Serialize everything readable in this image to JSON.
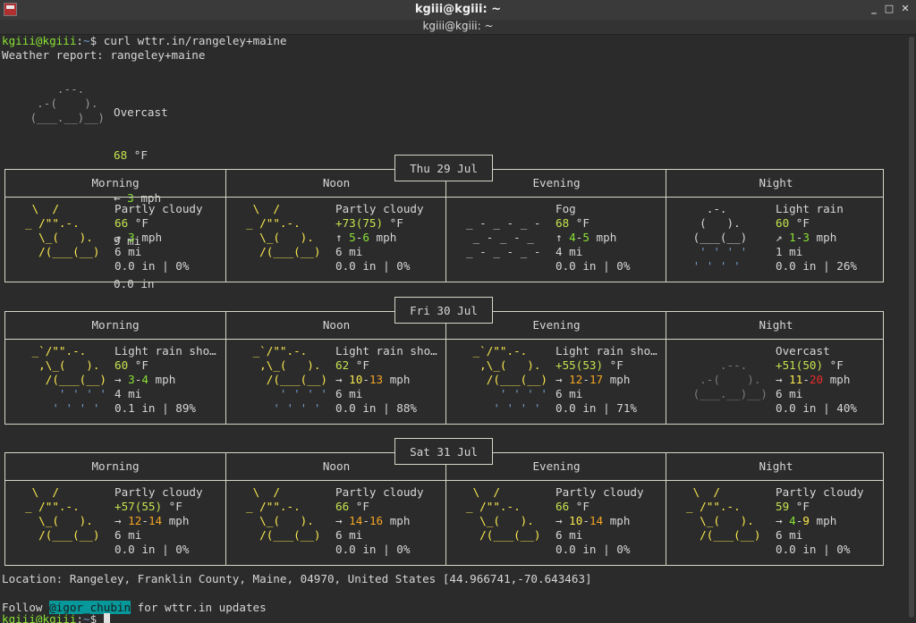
{
  "window": {
    "title": "kgiii@kgiii: ~",
    "tab_title": "kgiii@kgiii: ~"
  },
  "prompt": {
    "user_host": "kgiii@kgiii",
    "sep": ":",
    "path": "~",
    "symbol": "$ ",
    "command": "curl wttr.in/rangeley+maine"
  },
  "report_header": "Weather report: rangeley+maine",
  "current": {
    "icon": [
      "     .--.",
      "  .-(    ).",
      " (___.__)__)"
    ],
    "condition": "Overcast",
    "temp": "68",
    "temp_unit": " °F",
    "wind_dir": "← ",
    "wind": "3",
    "wind_unit": " mph",
    "visibility": "9 mi",
    "precip": "0.0 in"
  },
  "forecast": [
    {
      "date": "Thu 29 Jul",
      "periods": [
        {
          "name": "Morning",
          "icon": [
            " \\  /",
            "_ /\"\".-.",
            "  \\_(   ).",
            "  /(___(__)"
          ],
          "icon_color": "#fce94f",
          "condition": "Partly cloudy",
          "temp_a": "66",
          "temp_b": "",
          "temp_unit": " °F",
          "wind_dir": "↗ ",
          "wind_a": "3",
          "wind_b": "",
          "wind_unit": " mph",
          "visibility": "6 mi",
          "precip": "0.0 in | 0%"
        },
        {
          "name": "Noon",
          "icon": [
            " \\  /",
            "_ /\"\".-.",
            "  \\_(   ).",
            "  /(___(__)"
          ],
          "icon_color": "#fce94f",
          "condition": "Partly cloudy",
          "temp_a": "+73",
          "temp_b": "(75)",
          "temp_unit": " °F",
          "wind_dir": "↑ ",
          "wind_a": "5",
          "wind_b": "6",
          "wind_unit": " mph",
          "visibility": "6 mi",
          "precip": "0.0 in | 0%"
        },
        {
          "name": "Evening",
          "icon": [
            "",
            "_ - _ - _ -",
            " _ - _ - _",
            "_ - _ - _ -"
          ],
          "icon_color": "#d6d6d6",
          "condition": "Fog",
          "temp_a": "68",
          "temp_b": "",
          "temp_unit": " °F",
          "wind_dir": "↑ ",
          "wind_a": "4",
          "wind_b": "5",
          "wind_unit": " mph",
          "visibility": "4 mi",
          "precip": "0.0 in | 0%"
        },
        {
          "name": "Night",
          "icon": [
            "   .-.",
            "  (   ).",
            " (___(__)",
            "  ' ' ' '",
            " ' ' ' '"
          ],
          "icon_color": "#d6d6d6",
          "condition": "Light rain",
          "temp_a": "60",
          "temp_b": "",
          "temp_unit": " °F",
          "wind_dir": "↗ ",
          "wind_a": "1",
          "wind_b": "3",
          "wind_unit": " mph",
          "visibility": "1 mi",
          "precip": "0.0 in | 26%"
        }
      ]
    },
    {
      "date": "Fri 30 Jul",
      "periods": [
        {
          "name": "Morning",
          "icon": [
            " _`/\"\".-.",
            "  ,\\_(   ).",
            "   /(___(__)",
            "     ' ' ' '",
            "    ' ' ' '"
          ],
          "icon_color": "#fce94f",
          "condition": "Light rain sho…",
          "temp_a": "60",
          "temp_b": "",
          "temp_unit": " °F",
          "wind_dir": "→ ",
          "wind_a": "3",
          "wind_b": "4",
          "wind_unit": " mph",
          "visibility": "4 mi",
          "precip": "0.1 in | 89%"
        },
        {
          "name": "Noon",
          "icon": [
            " _`/\"\".-.",
            "  ,\\_(   ).",
            "   /(___(__)",
            "     ' ' ' '",
            "    ' ' ' '"
          ],
          "icon_color": "#fce94f",
          "condition": "Light rain sho…",
          "temp_a": "62",
          "temp_b": "",
          "temp_unit": " °F",
          "wind_dir": "→ ",
          "wind_a": "10",
          "wind_b": "13",
          "wind_unit": " mph",
          "visibility": "6 mi",
          "precip": "0.0 in | 88%"
        },
        {
          "name": "Evening",
          "icon": [
            " _`/\"\".-.",
            "  ,\\_(   ).",
            "   /(___(__)",
            "     ' ' ' '",
            "    ' ' ' '"
          ],
          "icon_color": "#fce94f",
          "condition": "Light rain sho…",
          "temp_a": "+55",
          "temp_b": "(53)",
          "temp_unit": " °F",
          "wind_dir": "→ ",
          "wind_a": "12",
          "wind_b": "17",
          "wind_unit": " mph",
          "visibility": "6 mi",
          "precip": "0.0 in | 71%"
        },
        {
          "name": "Night",
          "icon": [
            "",
            "     .--.",
            "  .-(    ).",
            " (___.__)__)"
          ],
          "icon_color": "#7a7a7a",
          "condition": "Overcast",
          "temp_a": "+51",
          "temp_b": "(50)",
          "temp_unit": " °F",
          "wind_dir": "→ ",
          "wind_a": "11",
          "wind_b": "20",
          "wind_unit": " mph",
          "visibility": "6 mi",
          "precip": "0.0 in | 40%"
        }
      ]
    },
    {
      "date": "Sat 31 Jul",
      "periods": [
        {
          "name": "Morning",
          "icon": [
            " \\  /",
            "_ /\"\".-.",
            "  \\_(   ).",
            "  /(___(__)"
          ],
          "icon_color": "#fce94f",
          "condition": "Partly cloudy",
          "temp_a": "+57",
          "temp_b": "(55)",
          "temp_unit": " °F",
          "wind_dir": "→ ",
          "wind_a": "12",
          "wind_b": "14",
          "wind_unit": " mph",
          "visibility": "6 mi",
          "precip": "0.0 in | 0%"
        },
        {
          "name": "Noon",
          "icon": [
            " \\  /",
            "_ /\"\".-.",
            "  \\_(   ).",
            "  /(___(__)"
          ],
          "icon_color": "#fce94f",
          "condition": "Partly cloudy",
          "temp_a": "66",
          "temp_b": "",
          "temp_unit": " °F",
          "wind_dir": "→ ",
          "wind_a": "14",
          "wind_b": "16",
          "wind_unit": " mph",
          "visibility": "6 mi",
          "precip": "0.0 in | 0%"
        },
        {
          "name": "Evening",
          "icon": [
            " \\  /",
            "_ /\"\".-.",
            "  \\_(   ).",
            "  /(___(__)"
          ],
          "icon_color": "#fce94f",
          "condition": "Partly cloudy",
          "temp_a": "66",
          "temp_b": "",
          "temp_unit": " °F",
          "wind_dir": "→ ",
          "wind_a": "10",
          "wind_b": "14",
          "wind_unit": " mph",
          "visibility": "6 mi",
          "precip": "0.0 in | 0%"
        },
        {
          "name": "Night",
          "icon": [
            " \\  /",
            "_ /\"\".-.",
            "  \\_(   ).",
            "  /(___(__)"
          ],
          "icon_color": "#fce94f",
          "condition": "Partly cloudy",
          "temp_a": "59",
          "temp_b": "",
          "temp_unit": " °F",
          "wind_dir": "→ ",
          "wind_a": "4",
          "wind_b": "9",
          "wind_unit": " mph",
          "visibility": "6 mi",
          "precip": "0.0 in | 0%"
        }
      ]
    }
  ],
  "location_line": "Location: Rangeley, Franklin County, Maine, 04970, United States [44.966741,-70.643463]",
  "follow": {
    "prefix": "Follow ",
    "handle": "@igor_chubin",
    "suffix": " for wttr.in updates"
  },
  "prompt2": {
    "user_host": "kgiii@kgiii",
    "sep": ":",
    "path": "~",
    "symbol": "$ "
  },
  "icons": {
    "app": "terminal-icon",
    "minimize": "_",
    "maximize": "□",
    "close": "✕"
  },
  "colors": {
    "background": "#2b2b2b",
    "prompt_green": "#8ae234",
    "prompt_blue": "#729fcf",
    "temp_yellow": "#fce94f",
    "wind_orange": "#f5a623",
    "wind_red": "#ef2929",
    "highlight": "#06989a"
  }
}
